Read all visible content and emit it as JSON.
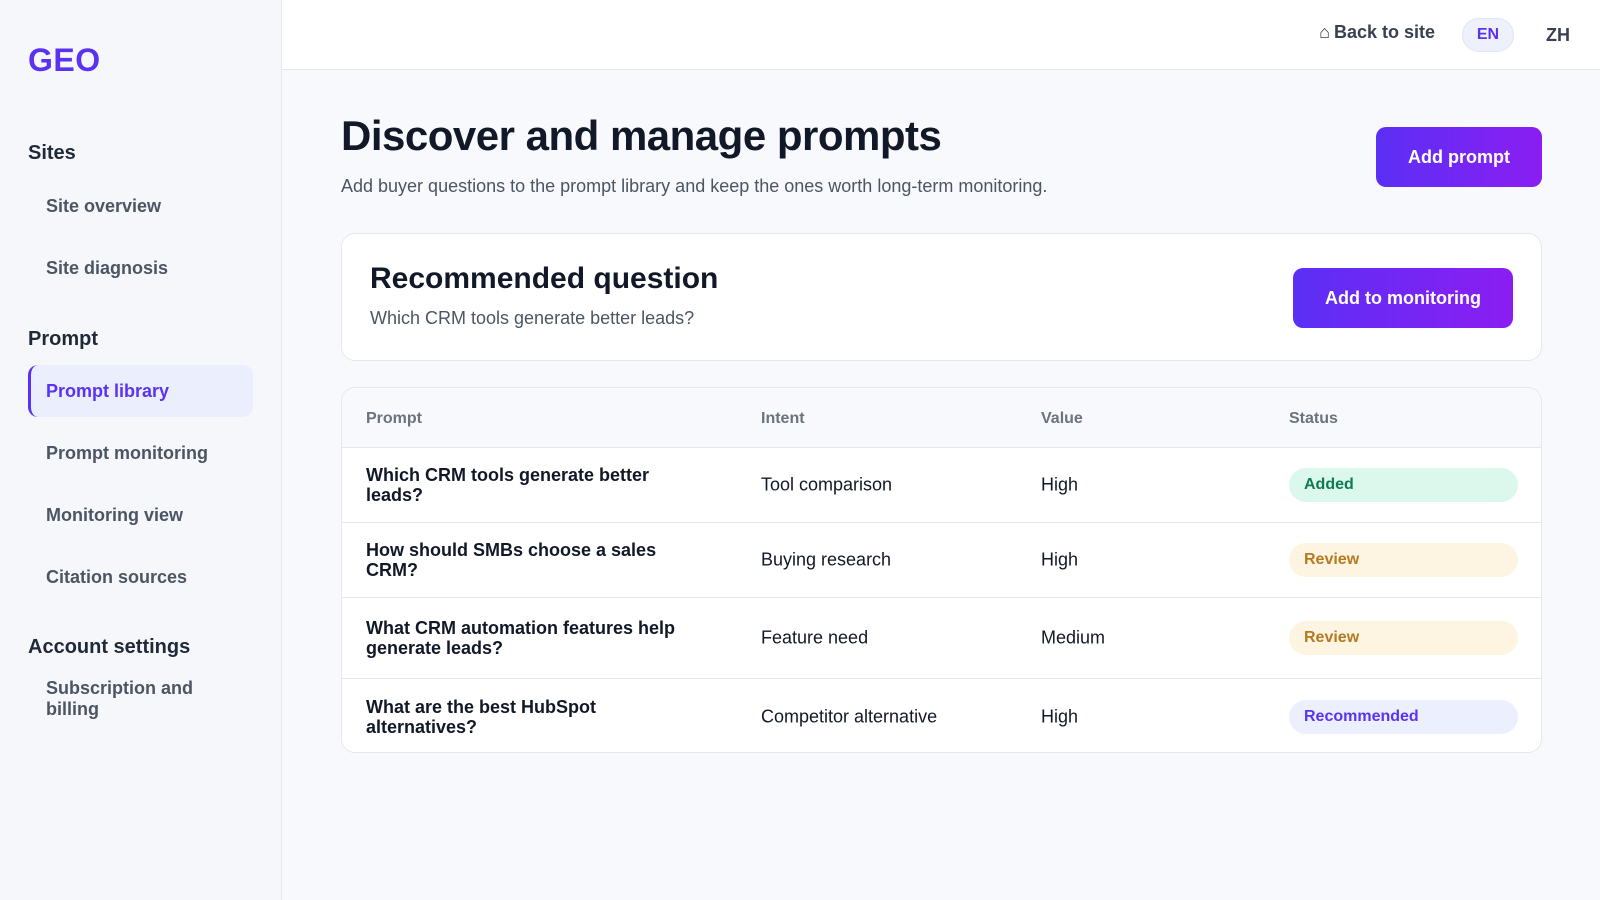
{
  "sidebar": {
    "logo": "GEO",
    "sections": [
      {
        "title": "Sites",
        "items": [
          "Site overview",
          "Site diagnosis"
        ]
      },
      {
        "title": "Prompt",
        "items": [
          "Prompt library",
          "Prompt monitoring",
          "Monitoring view",
          "Citation sources"
        ]
      },
      {
        "title": "Account settings",
        "items": [
          "Subscription and billing"
        ]
      }
    ],
    "active_item": "Prompt library"
  },
  "topbar": {
    "back_icon": "home-icon",
    "back_label": "Back to site",
    "languages": [
      "EN",
      "ZH"
    ],
    "active_language": "EN"
  },
  "header": {
    "title": "Discover and manage prompts",
    "subtitle": "Add buyer questions to the prompt library and keep the ones worth long-term monitoring.",
    "add_prompt_label": "Add prompt"
  },
  "recommended": {
    "title": "Recommended question",
    "question": "Which CRM tools generate better leads?",
    "button_label": "Add to monitoring"
  },
  "table": {
    "columns": [
      "Prompt",
      "Intent",
      "Value",
      "Status"
    ],
    "rows": [
      {
        "prompt": "Which CRM tools generate better leads?",
        "intent": "Tool comparison",
        "value": "High",
        "status": "Added"
      },
      {
        "prompt": "How should SMBs choose a sales CRM?",
        "intent": "Buying research",
        "value": "High",
        "status": "Review"
      },
      {
        "prompt": "What CRM automation features help generate leads?",
        "intent": "Feature need",
        "value": "Medium",
        "status": "Review"
      },
      {
        "prompt": "What are the best HubSpot alternatives?",
        "intent": "Competitor alternative",
        "value": "High",
        "status": "Recommended"
      }
    ]
  },
  "colors": {
    "accent": "#5b32f2",
    "status_added_bg": "#dcf7ec",
    "status_added_text": "#0f7a55",
    "status_review_bg": "#fdf5e2",
    "status_review_text": "#b7791f",
    "status_recommended_bg": "#eceffd",
    "status_recommended_text": "#5b32f2"
  }
}
